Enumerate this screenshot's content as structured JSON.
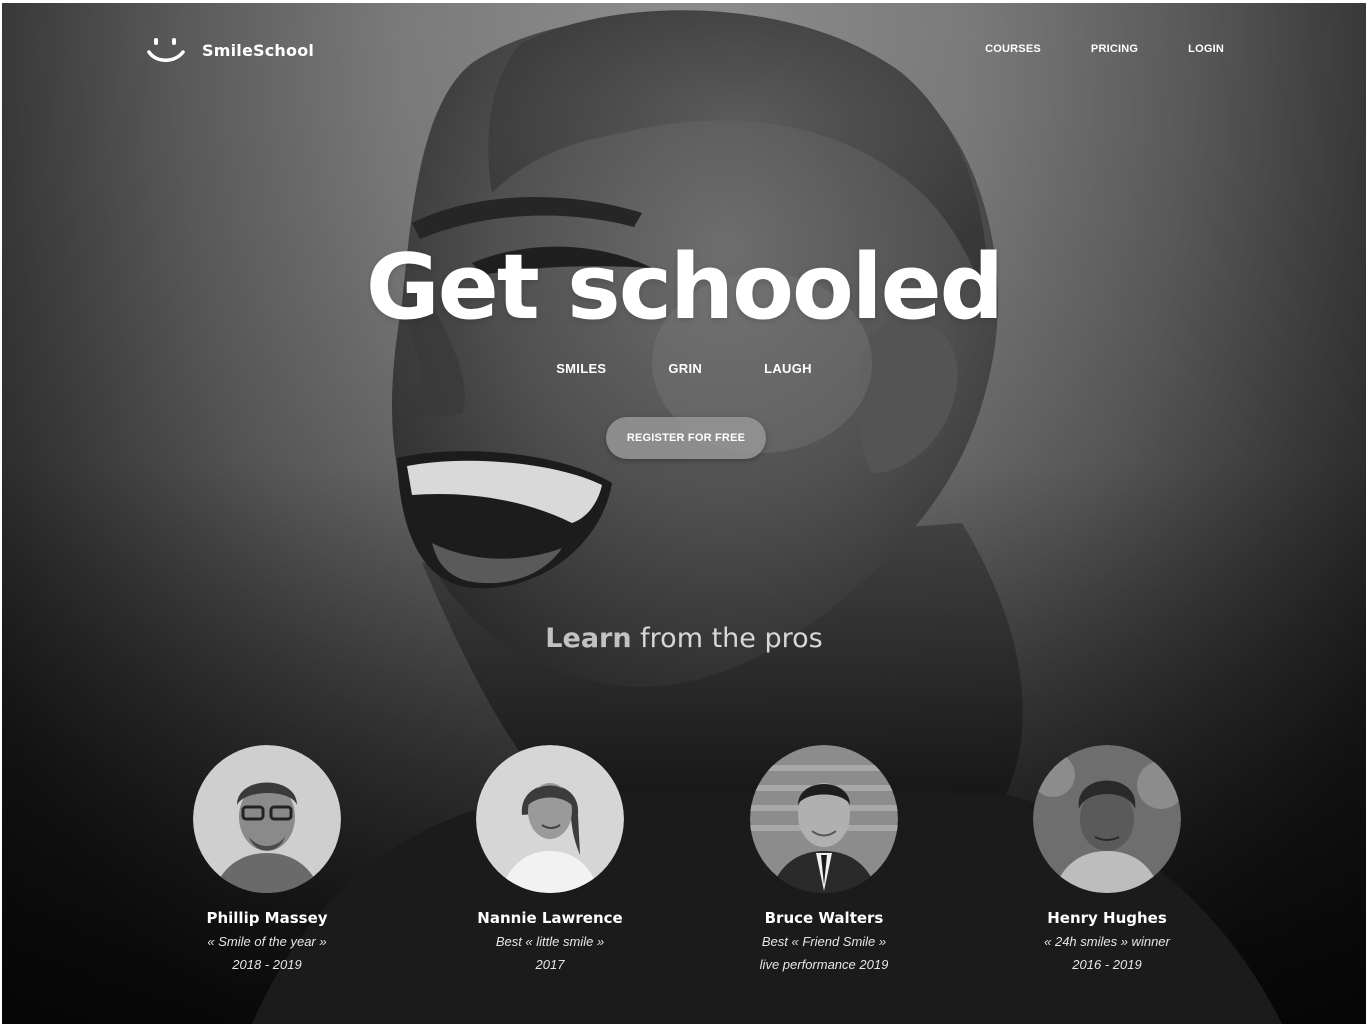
{
  "brand": {
    "name": "SmileSchool",
    "logo_icon": "smiley-face-icon"
  },
  "nav": {
    "items": [
      {
        "label": "COURSES"
      },
      {
        "label": "PRICING"
      },
      {
        "label": "LOGIN"
      }
    ]
  },
  "hero": {
    "title": "Get schooled",
    "tags": [
      "SMILES",
      "GRIN",
      "LAUGH"
    ],
    "cta_label": "REGISTER FOR FREE"
  },
  "learn": {
    "heading_strong": "Learn",
    "heading_rest": " from the pros"
  },
  "pros": [
    {
      "name": "Phillip Massey",
      "line1": "« Smile of the year »",
      "line2": "2018 - 2019"
    },
    {
      "name": "Nannie Lawrence",
      "line1": "Best « little smile »",
      "line2": "2017"
    },
    {
      "name": "Bruce Walters",
      "line1": "Best « Friend Smile »",
      "line2": "live performance 2019"
    },
    {
      "name": "Henry Hughes",
      "line1": "« 24h smiles » winner",
      "line2": "2016 - 2019"
    }
  ],
  "colors": {
    "background_dark": "#151515",
    "background_light": "#8f8f8f",
    "button": "#969696",
    "text": "#ffffff"
  }
}
